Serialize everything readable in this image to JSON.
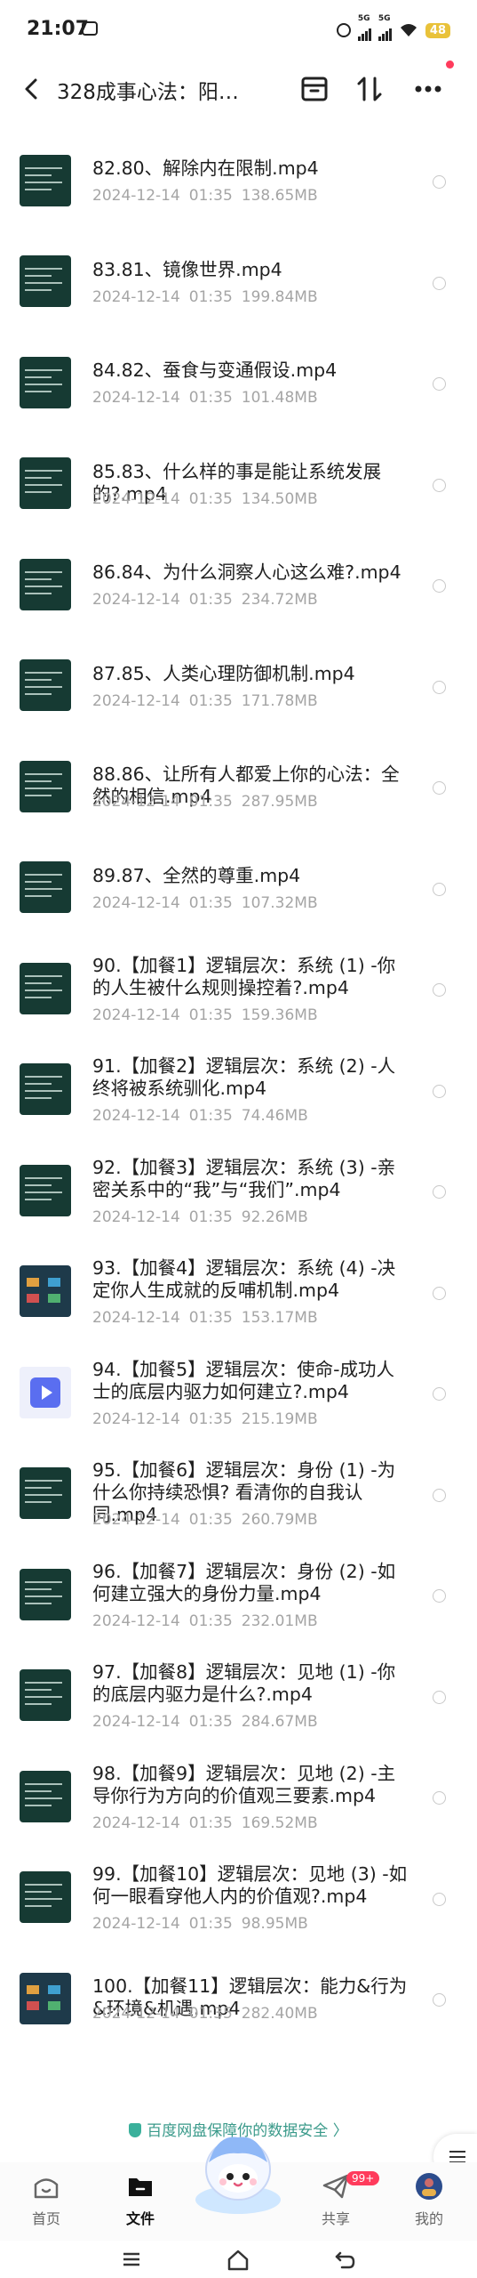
{
  "status_bar": {
    "time": "21:07",
    "signal1": "5G",
    "signal2": "5G",
    "battery": "48"
  },
  "header": {
    "title": "328成事心法：阳…"
  },
  "files": [
    {
      "name": "82.80、解除内在限制.mp4",
      "date": "2024-12-14",
      "time": "01:35",
      "size": "138.65MB",
      "thumb": "slide"
    },
    {
      "name": "83.81、镜像世界.mp4",
      "date": "2024-12-14",
      "time": "01:35",
      "size": "199.84MB",
      "thumb": "slide"
    },
    {
      "name": "84.82、蚕食与变通假设.mp4",
      "date": "2024-12-14",
      "time": "01:35",
      "size": "101.48MB",
      "thumb": "slide"
    },
    {
      "name": "85.83、什么样的事是能让系统发展的?.mp4",
      "date": "2024-12-14",
      "time": "01:35",
      "size": "134.50MB",
      "thumb": "slide"
    },
    {
      "name": "86.84、为什么洞察人心这么难?.mp4",
      "date": "2024-12-14",
      "time": "01:35",
      "size": "234.72MB",
      "thumb": "slide"
    },
    {
      "name": "87.85、人类心理防御机制.mp4",
      "date": "2024-12-14",
      "time": "01:35",
      "size": "171.78MB",
      "thumb": "slide"
    },
    {
      "name": "88.86、让所有人都爱上你的心法：全然的相信.mp4",
      "date": "2024-12-14",
      "time": "01:35",
      "size": "287.95MB",
      "thumb": "slide"
    },
    {
      "name": "89.87、全然的尊重.mp4",
      "date": "2024-12-14",
      "time": "01:35",
      "size": "107.32MB",
      "thumb": "slide"
    },
    {
      "name": "90.【加餐1】逻辑层次：系统 (1) -你的人生被什么规则操控着?.mp4",
      "date": "2024-12-14",
      "time": "01:35",
      "size": "159.36MB",
      "thumb": "slide"
    },
    {
      "name": "91.【加餐2】逻辑层次：系统 (2) -人终将被系统驯化.mp4",
      "date": "2024-12-14",
      "time": "01:35",
      "size": "74.46MB",
      "thumb": "slide"
    },
    {
      "name": "92.【加餐3】逻辑层次：系统 (3) -亲密关系中的“我”与“我们”.mp4",
      "date": "2024-12-14",
      "time": "01:35",
      "size": "92.26MB",
      "thumb": "slide"
    },
    {
      "name": "93.【加餐4】逻辑层次：系统 (4) -决定你人生成就的反哺机制.mp4",
      "date": "2024-12-14",
      "time": "01:35",
      "size": "153.17MB",
      "thumb": "colorful"
    },
    {
      "name": "94.【加餐5】逻辑层次：使命-成功人士的底层内驱力如何建立?.mp4",
      "date": "2024-12-14",
      "time": "01:35",
      "size": "215.19MB",
      "thumb": "video"
    },
    {
      "name": "95.【加餐6】逻辑层次：身份 (1) -为什么你持续恐惧? 看清你的自我认同.mp4",
      "date": "2024-12-14",
      "time": "01:35",
      "size": "260.79MB",
      "thumb": "slide"
    },
    {
      "name": "96.【加餐7】逻辑层次：身份 (2) -如何建立强大的身份力量.mp4",
      "date": "2024-12-14",
      "time": "01:35",
      "size": "232.01MB",
      "thumb": "slide"
    },
    {
      "name": "97.【加餐8】逻辑层次：见地 (1) -你的底层内驱力是什么?.mp4",
      "date": "2024-12-14",
      "time": "01:35",
      "size": "284.67MB",
      "thumb": "slide"
    },
    {
      "name": "98.【加餐9】逻辑层次：见地 (2) -主导你行为方向的价值观三要素.mp4",
      "date": "2024-12-14",
      "time": "01:35",
      "size": "169.52MB",
      "thumb": "slide"
    },
    {
      "name": "99.【加餐10】逻辑层次：见地 (3) -如何一眼看穿他人内的价值观?.mp4",
      "date": "2024-12-14",
      "time": "01:35",
      "size": "98.95MB",
      "thumb": "slide"
    },
    {
      "name": "100.【加餐11】逻辑层次：能力&行为&环境&机遇.mp4",
      "date": "2024-12-14",
      "time": "01:35",
      "size": "282.40MB",
      "thumb": "colorful"
    }
  ],
  "security": {
    "text": "百度网盘保障你的数据安全 〉"
  },
  "nav": {
    "home": "首页",
    "files": "文件",
    "share": "共享",
    "share_badge": "99+",
    "mine": "我的"
  },
  "colors": {
    "accent": "#5a6ef0",
    "security": "#3a9a8a",
    "badge": "#ff3b5c"
  }
}
